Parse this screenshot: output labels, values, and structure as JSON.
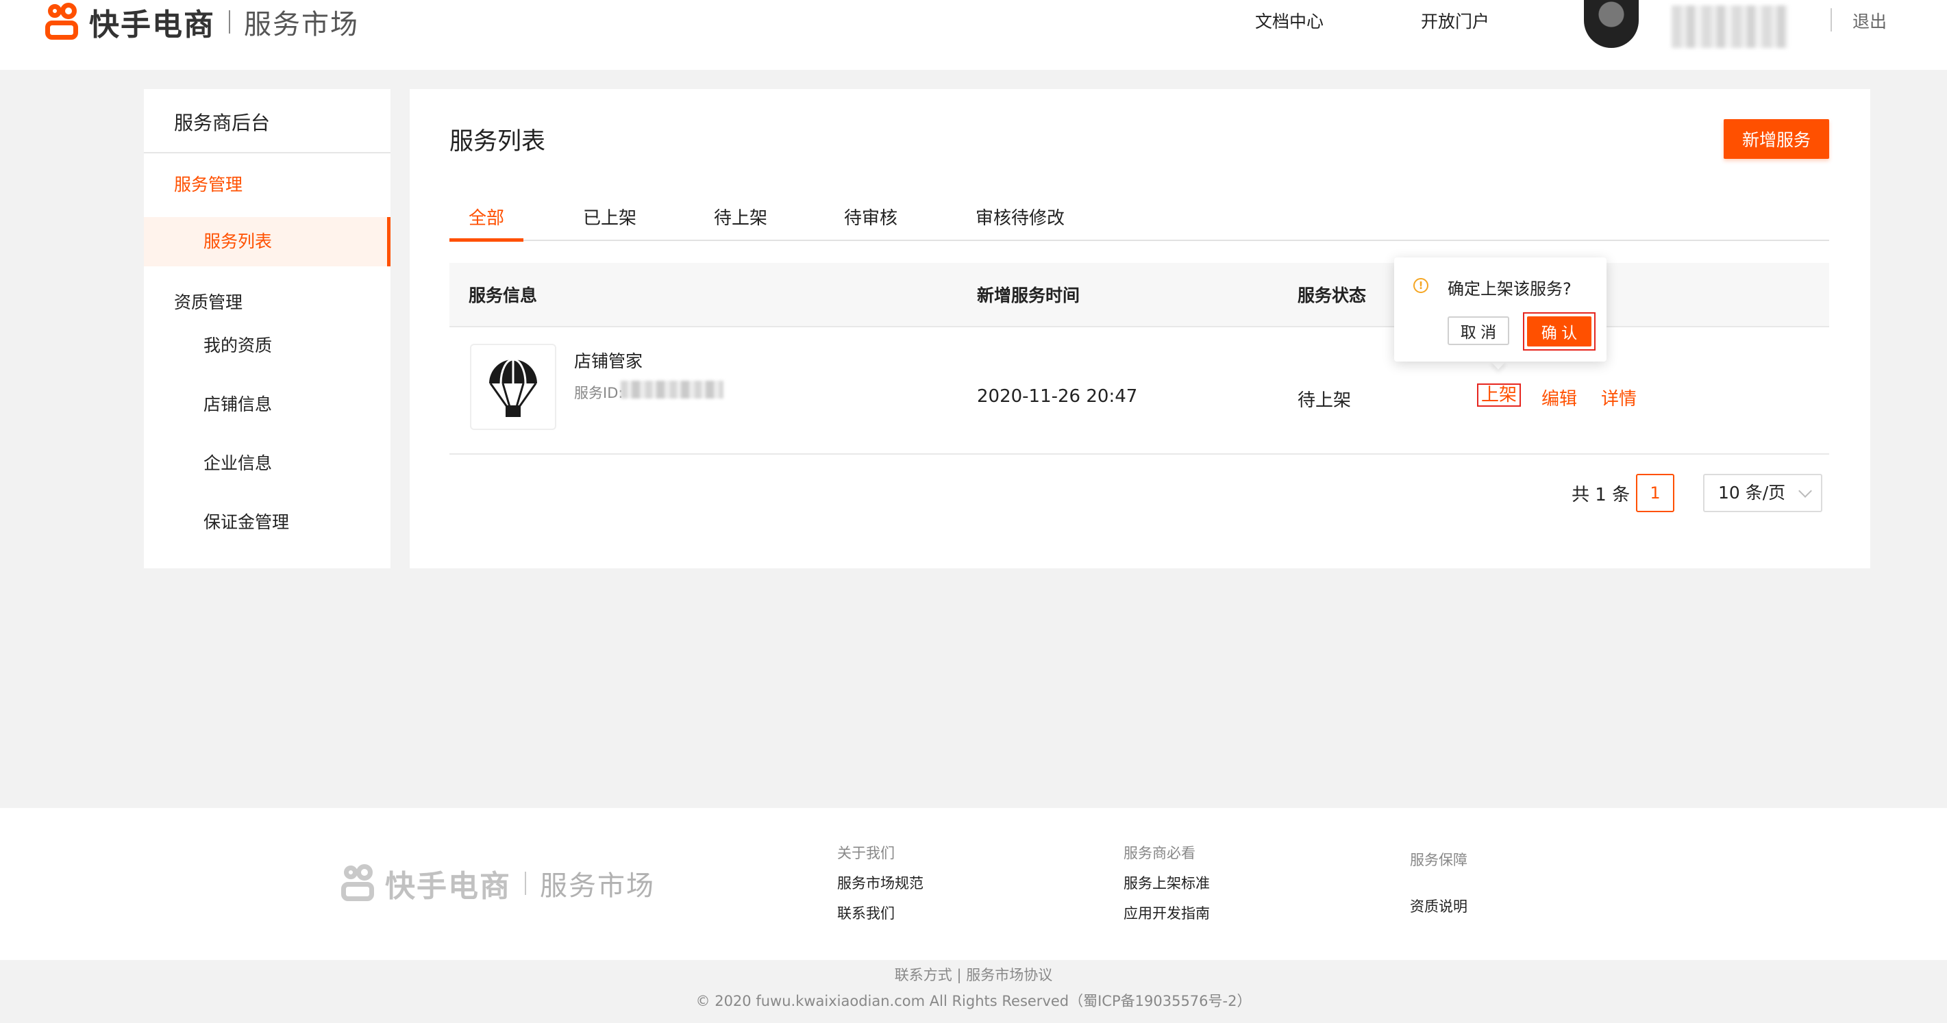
{
  "header": {
    "brand": "快手电商",
    "subtitle": "服务市场",
    "nav": [
      "文档中心",
      "开放门户"
    ],
    "logout": "退出"
  },
  "sidebar": {
    "title": "服务商后台",
    "groups": [
      {
        "label": "服务管理",
        "items": [
          "服务列表"
        ]
      },
      {
        "label": "资质管理",
        "items": [
          "我的资质",
          "店铺信息",
          "企业信息",
          "保证金管理"
        ]
      }
    ]
  },
  "main": {
    "title": "服务列表",
    "add_button": "新增服务",
    "tabs": [
      "全部",
      "已上架",
      "待上架",
      "待审核",
      "审核待修改"
    ],
    "active_tab": "全部",
    "columns": [
      "服务信息",
      "新增服务时间",
      "服务状态"
    ],
    "rows": [
      {
        "name": "店铺管家",
        "id_label": "服务ID:",
        "created": "2020-11-26 20:47",
        "status": "待上架",
        "actions": [
          "上架",
          "编辑",
          "详情"
        ]
      }
    ],
    "pagination": {
      "total": "共 1 条",
      "current_page": "1",
      "page_size": "10 条/页"
    }
  },
  "popconfirm": {
    "icon": "info-icon",
    "message": "确定上架该服务?",
    "cancel": "取 消",
    "ok": "确 认"
  },
  "footer": {
    "brand": "快手电商",
    "subtitle": "服务市场",
    "columns": [
      {
        "title": "关于我们",
        "links": [
          "服务市场规范",
          "联系我们"
        ]
      },
      {
        "title": "服务商必看",
        "links": [
          "服务上架标准",
          "应用开发指南"
        ]
      },
      {
        "title": "服务保障",
        "links": [
          "资质说明"
        ]
      }
    ],
    "bottom_links": "联系方式 | 服务市场协议",
    "copyright": "© 2020 fuwu.kwaixiaodian.com All Rights Reserved（蜀ICP备19035576号-2）"
  },
  "colors": {
    "accent": "#ff5000",
    "highlight_box": "#e6261f",
    "warning": "#f5a623"
  }
}
